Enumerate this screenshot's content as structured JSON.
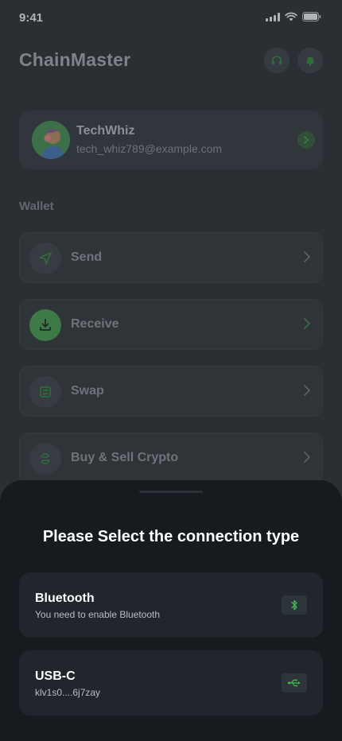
{
  "status_bar": {
    "time": "9:41",
    "icons": [
      "signal-icon",
      "wifi-icon",
      "battery-icon"
    ]
  },
  "header": {
    "title": "ChainMaster",
    "actions": [
      "headset-icon",
      "bell-icon"
    ]
  },
  "profile": {
    "name": "TechWhiz",
    "email": "tech_whiz789@example.com"
  },
  "wallet": {
    "section_label": "Wallet",
    "items": [
      {
        "label": "Send",
        "icon": "send-icon"
      },
      {
        "label": "Receive",
        "icon": "download-icon"
      },
      {
        "label": "Swap",
        "icon": "swap-icon"
      },
      {
        "label": "Buy & Sell Crypto",
        "icon": "exchange-icon"
      }
    ]
  },
  "sheet": {
    "title": "Please Select the connection type",
    "options": [
      {
        "title": "Bluetooth",
        "subtitle": "You need to enable Bluetooth",
        "icon": "bluetooth-icon"
      },
      {
        "title": "USB-C",
        "subtitle": "klv1s0....6j7zay",
        "icon": "usb-icon"
      }
    ]
  },
  "colors": {
    "accent_green": "#3fbf4e",
    "sheet_bg": "#161b20",
    "card_bg": "#20262c",
    "overlay_bg": "#2a2f33"
  }
}
